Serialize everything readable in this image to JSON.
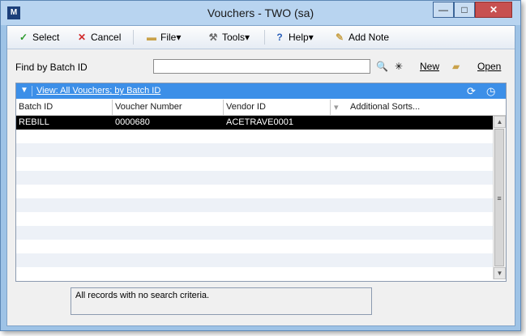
{
  "window": {
    "title": "Vouchers  -  TWO (sa)",
    "app_icon": "M",
    "min_icon": "—",
    "max_icon": "□",
    "close_icon": "✕"
  },
  "toolbar": {
    "select_label": "Select",
    "cancel_label": "Cancel",
    "file_label": "File",
    "tools_label": "Tools",
    "help_label": "Help",
    "add_note_label": "Add Note",
    "dropdown_glyph": "▾"
  },
  "find": {
    "label": "Find by Batch ID",
    "value": "",
    "new_label": "New",
    "open_label": "Open"
  },
  "view": {
    "label": "View: All Vouchers; by Batch ID"
  },
  "columns": [
    "Batch ID",
    "Voucher Number",
    "Vendor ID",
    "Additional Sorts..."
  ],
  "rows": [
    {
      "batch_id": "REBILL",
      "voucher_number": "0000680",
      "vendor_id": "ACETRAVE0001"
    }
  ],
  "status_text": "All records with no search criteria.",
  "colors": {
    "view_bar": "#3c8fe8",
    "selected_row": "#000000",
    "title_bar": "#b8d4f0"
  }
}
